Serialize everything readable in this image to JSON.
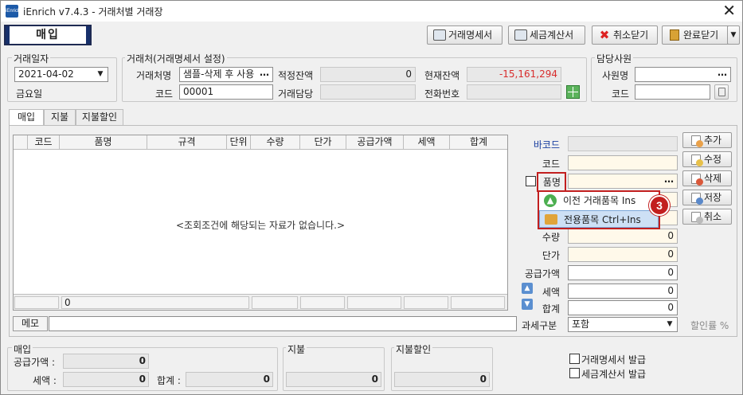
{
  "window": {
    "app_icon_text": "iEnrich",
    "title": "iEnrich v7.4.3 - 거래처별 거래장",
    "close_glyph": "✕"
  },
  "mode_label": "매입",
  "toolbar": {
    "statement_btn": "거래명세서",
    "tax_invoice_btn": "세금계산서",
    "cancel_close_btn": "취소닫기",
    "done_close_btn": "완료닫기"
  },
  "date_group": {
    "label": "거래일자",
    "date": "2021-04-02",
    "weekday": "금요일"
  },
  "partner_group": {
    "label": "거래처(거래명세서 설정)",
    "partner_label": "거래처명",
    "partner_value": "샘플-삭제 후 사용",
    "code_label": "코드",
    "code_value": "00001",
    "balance_label": "적정잔액",
    "balance_value": "0",
    "current_label": "현재잔액",
    "current_value": "-15,161,294",
    "manager_label": "거래담당",
    "manager_value": "",
    "phone_label": "전화번호",
    "phone_value": ""
  },
  "staff_group": {
    "label": "담당사원",
    "name_label": "사원명",
    "name_value": "",
    "code_label": "코드",
    "code_value": ""
  },
  "tabs": [
    "매입",
    "지불",
    "지불할인"
  ],
  "grid": {
    "columns": [
      "코드",
      "품명",
      "규격",
      "단위",
      "수량",
      "단가",
      "공급가액",
      "세액",
      "합계"
    ],
    "empty_message": "<조회조건에 해당되는 자료가 없습니다.>",
    "footer_qty": "0"
  },
  "entry": {
    "barcode_label": "바코드",
    "code_label": "코드",
    "item_label": "품명",
    "qty_label": "수량",
    "price_label": "단가",
    "supply_label": "공급가액",
    "tax_label": "세액",
    "total_label": "합계",
    "qty_value": "0",
    "price_value": "0",
    "supply_value": "0",
    "tax_value": "0",
    "total_value": "0",
    "tax_type_label": "과세구분",
    "tax_type_value": "포함",
    "discount_label": "할인률 %"
  },
  "side_buttons": {
    "add": "추가",
    "edit": "수정",
    "delete": "삭제",
    "save": "저장",
    "cancel": "취소"
  },
  "context_menu": {
    "items": [
      "이전 거래품목 Ins",
      "전용품목 Ctrl+Ins"
    ],
    "badge": "3"
  },
  "memo": {
    "label": "메모",
    "value": ""
  },
  "summary": {
    "purchase_title": "매입",
    "supply_label": "공급가액 :",
    "supply_value": "0",
    "tax_label": "세액 :",
    "tax_value": "0",
    "total_label": "합계 :",
    "total_value": "0",
    "pay_title": "지불",
    "pay_value": "0",
    "pay_discount_title": "지불할인",
    "pay_discount_value": "0"
  },
  "issue_options": {
    "statement": "거래명세서 발급",
    "tax_invoice": "세금계산서 발급"
  },
  "colors": {
    "accent_red": "#c21f1f",
    "negative": "#d82c2c",
    "link_blue": "#1a3fa0"
  }
}
